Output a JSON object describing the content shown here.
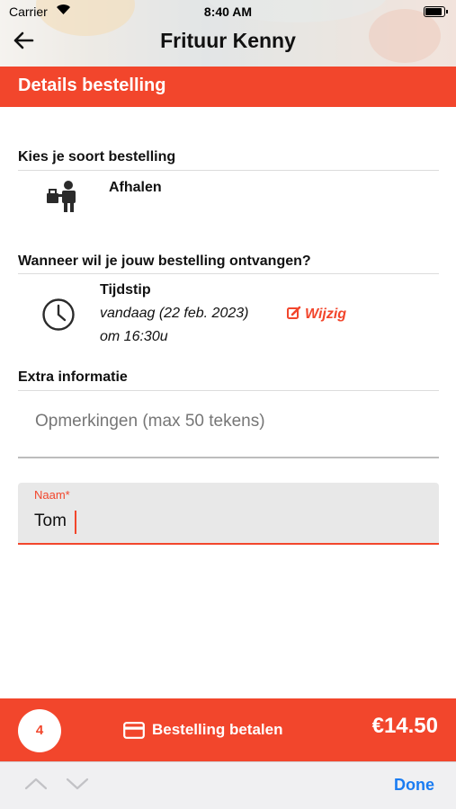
{
  "status_bar": {
    "carrier": "Carrier",
    "time": "8:40 AM"
  },
  "header": {
    "title": "Frituur Kenny",
    "back_icon": "arrow-left-icon"
  },
  "section": {
    "title": "Details bestelling"
  },
  "order_type": {
    "heading": "Kies je soort bestelling",
    "option_label": "Afhalen",
    "icon": "takeaway-person-icon"
  },
  "delivery_time": {
    "heading": "Wanneer wil je jouw bestelling ontvangen?",
    "label": "Tijdstip",
    "date": "vandaag (22 feb. 2023)",
    "edit_label": "Wijzig",
    "time": "om 16:30u",
    "icon": "clock-icon"
  },
  "extra_info": {
    "heading": "Extra informatie",
    "remarks_placeholder": "Opmerkingen (max 50 tekens)",
    "remarks_value": "",
    "name_label": "Naam*",
    "name_value": "Tom"
  },
  "footer": {
    "item_count": "4",
    "pay_label": "Bestelling betalen",
    "total": "€14.50",
    "card_icon": "credit-card-icon"
  },
  "keyboard_toolbar": {
    "done_label": "Done"
  },
  "colors": {
    "accent": "#f2462c",
    "done_blue": "#1a7cf2"
  }
}
